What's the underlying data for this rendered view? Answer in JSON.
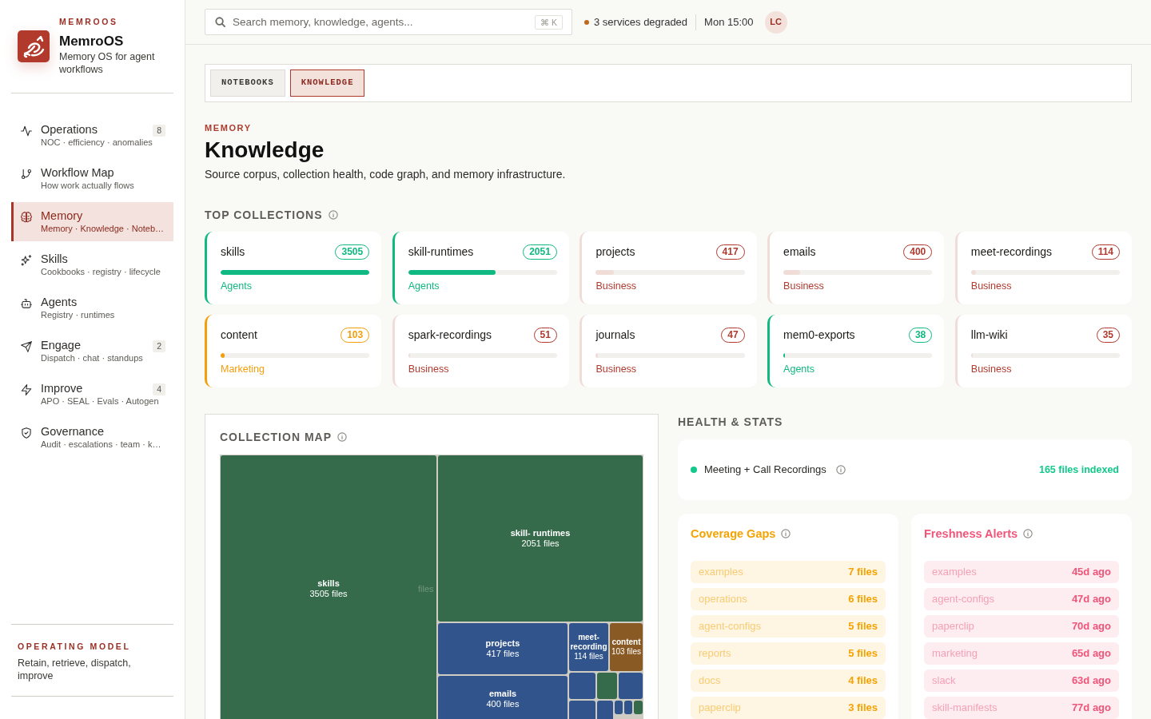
{
  "sidebar": {
    "kicker": "MEMROOS",
    "app_name": "MemroOS",
    "tagline": "Memory OS for agent workflows",
    "items": [
      {
        "label": "Operations",
        "subtitle": "NOC · efficiency · anomalies",
        "badge": "8",
        "selected": false
      },
      {
        "label": "Workflow Map",
        "subtitle": "How work actually flows",
        "selected": false
      },
      {
        "label": "Memory",
        "subtitle": "Memory · Knowledge · Noteb…",
        "selected": true
      },
      {
        "label": "Skills",
        "subtitle": "Cookbooks · registry · lifecycle",
        "selected": false
      },
      {
        "label": "Agents",
        "subtitle": "Registry · runtimes",
        "selected": false
      },
      {
        "label": "Engage",
        "subtitle": "Dispatch · chat · standups",
        "badge": "2",
        "selected": false
      },
      {
        "label": "Improve",
        "subtitle": "APO · SEAL · Evals · Autogen",
        "badge": "4",
        "selected": false
      },
      {
        "label": "Governance",
        "subtitle": "Audit · escalations · team · k…",
        "selected": false
      }
    ],
    "footer": {
      "kicker": "OPERATING MODEL",
      "text": "Retain, retrieve, dispatch, improve"
    }
  },
  "topbar": {
    "search": {
      "placeholder": "Search memory, knowledge, agents...",
      "shortcut": "⌘ K"
    },
    "status": {
      "text": "3 services degraded",
      "color": "#c0691c"
    },
    "clock": "Mon 15:00",
    "avatar": "LC"
  },
  "tabs": [
    {
      "label": "NOTEBOOKS",
      "selected": false
    },
    {
      "label": "KNOWLEDGE",
      "selected": true
    }
  ],
  "page": {
    "kicker": "MEMORY",
    "title": "Knowledge",
    "subtitle": "Source corpus, collection health, code graph, and memory infrastructure."
  },
  "top_collections": {
    "title": "TOP COLLECTIONS",
    "cards": [
      {
        "name": "skills",
        "count": "3505",
        "level": 1,
        "color": "#10b981",
        "category": {
          "label": "Agents",
          "color": "#10b981"
        }
      },
      {
        "name": "skill-runtimes",
        "count": "2051",
        "level": 0.585,
        "color": "#10b981",
        "category": {
          "label": "Agents",
          "color": "#10b981"
        }
      },
      {
        "name": "projects",
        "count": "417",
        "level": 0.119,
        "color": "#f0ddd7",
        "category": {
          "label": "Business",
          "color": "#b03a2e"
        }
      },
      {
        "name": "emails",
        "count": "400",
        "level": 0.114,
        "color": "#f0ddd7",
        "category": {
          "label": "Business",
          "color": "#b03a2e"
        }
      },
      {
        "name": "meet-recordings",
        "count": "114",
        "level": 0.033,
        "color": "#f0ddd7",
        "category": {
          "label": "Business",
          "color": "#b03a2e"
        }
      },
      {
        "name": "content",
        "count": "103",
        "level": 0.029,
        "color": "#f59e0b",
        "category": {
          "label": "Marketing",
          "color": "#f59e0b"
        }
      },
      {
        "name": "spark-recordings",
        "count": "51",
        "level": 0.015,
        "color": "#f0ddd7",
        "category": {
          "label": "Business",
          "color": "#b03a2e"
        }
      },
      {
        "name": "journals",
        "count": "47",
        "level": 0.013,
        "color": "#f0ddd7",
        "category": {
          "label": "Business",
          "color": "#b03a2e"
        }
      },
      {
        "name": "mem0-exports",
        "count": "38",
        "level": 0.011,
        "color": "#10b981",
        "category": {
          "label": "Agents",
          "color": "#10b981"
        }
      },
      {
        "name": "llm-wiki",
        "count": "35",
        "level": 0.01,
        "color": "#f0ddd7",
        "category": {
          "label": "Business",
          "color": "#b03a2e"
        }
      }
    ]
  },
  "collection_map": {
    "title": "COLLECTION MAP",
    "faded_label": "files",
    "tiles": [
      {
        "label": "skills",
        "files": "3505 files",
        "color": "#356b4b"
      },
      {
        "label": "skill- runtimes",
        "files": "2051 files",
        "color": "#356b4b"
      },
      {
        "label": "projects",
        "files": "417 files",
        "color": "#30548b"
      },
      {
        "label": "meet-recording",
        "files": "114 files",
        "color": "#30548b"
      },
      {
        "label": "content",
        "files": "103 files",
        "color": "#8a5a25"
      },
      {
        "label": "emails",
        "files": "400 files",
        "color": "#30548b"
      },
      {
        "color": "#30548b"
      },
      {
        "color": "#356b4b"
      },
      {
        "color": "#30548b"
      },
      {
        "color": "#30548b"
      },
      {
        "color": "#30548b"
      },
      {
        "color": "#30548b"
      },
      {
        "color": "#30548b"
      },
      {
        "color": "#356b4b"
      }
    ]
  },
  "health": {
    "title": "HEALTH & STATS",
    "summary": {
      "label": "Meeting + Call Recordings",
      "color": "#12c98a",
      "value": "165 files indexed"
    },
    "panels": [
      {
        "title": "Coverage Gaps",
        "color": "#f5a300",
        "rows": [
          {
            "name": "examples",
            "value": "7 files"
          },
          {
            "name": "operations",
            "value": "6 files"
          },
          {
            "name": "agent-configs",
            "value": "5 files"
          },
          {
            "name": "reports",
            "value": "5 files"
          },
          {
            "name": "docs",
            "value": "4 files"
          },
          {
            "name": "paperclip",
            "value": "3 files"
          }
        ]
      },
      {
        "title": "Freshness Alerts",
        "color": "#f0557a",
        "rows": [
          {
            "name": "examples",
            "value": "45d ago"
          },
          {
            "name": "agent-configs",
            "value": "47d ago"
          },
          {
            "name": "paperclip",
            "value": "70d ago"
          },
          {
            "name": "marketing",
            "value": "65d ago"
          },
          {
            "name": "slack",
            "value": "63d ago"
          },
          {
            "name": "skill-manifests",
            "value": "77d ago"
          }
        ]
      }
    ]
  }
}
